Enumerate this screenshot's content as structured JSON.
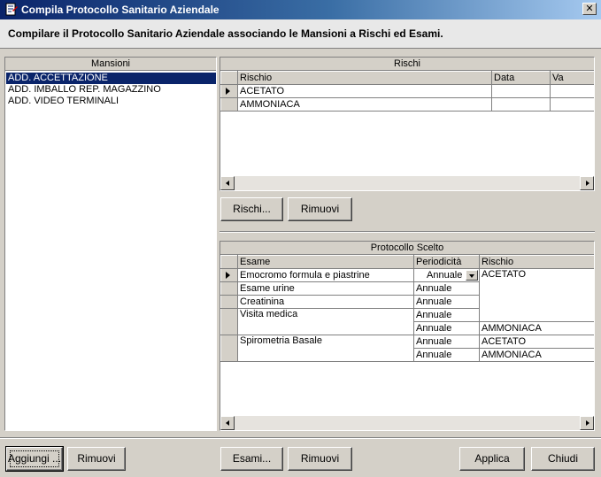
{
  "window": {
    "title": "Compila Protocollo Sanitario Aziendale",
    "close_glyph": "✕",
    "instruction": "Compilare il Protocollo Sanitario Aziendale associando le Mansioni a Rischi ed Esami."
  },
  "mansioni": {
    "caption": "Mansioni",
    "items": [
      "ADD. ACCETTAZIONE",
      "ADD. IMBALLO REP. MAGAZZINO",
      "ADD. VIDEO TERMINALI"
    ],
    "selected_index": 0
  },
  "rischi": {
    "caption": "Rischi",
    "columns": [
      "Rischio",
      "Data",
      "Va"
    ],
    "rows": [
      {
        "rischio": "ACETATO",
        "data": "",
        "va": ""
      },
      {
        "rischio": "AMMONIACA",
        "data": "",
        "va": ""
      }
    ],
    "buttons": {
      "add": "Rischi...",
      "remove": "Rimuovi"
    }
  },
  "protocollo": {
    "caption": "Protocollo Scelto",
    "columns": [
      "Esame",
      "Periodicità",
      "Rischio"
    ],
    "rows": [
      {
        "esame": "Emocromo formula e piastrine",
        "periodicita": "Annuale",
        "rischio": "ACETATO"
      },
      {
        "esame": "Esame urine",
        "periodicita": "Annuale",
        "rischio": ""
      },
      {
        "esame": "Creatinina",
        "periodicita": "Annuale",
        "rischio": ""
      },
      {
        "esame": "Visita medica",
        "periodicita": "Annuale",
        "rischio": ""
      },
      {
        "esame": "",
        "periodicita": "Annuale",
        "rischio": "AMMONIACA"
      },
      {
        "esame": "Spirometria Basale",
        "periodicita": "Annuale",
        "rischio": "ACETATO"
      },
      {
        "esame": "",
        "periodicita": "Annuale",
        "rischio": "AMMONIACA"
      }
    ]
  },
  "footer": {
    "aggiungi": "Aggiungi ...",
    "rimuovi_mansione": "Rimuovi",
    "esami": "Esami...",
    "rimuovi_esame": "Rimuovi",
    "applica": "Applica",
    "chiudi": "Chiudi"
  },
  "icons": {
    "window_icon": "form-icon",
    "row_indicator": "row-pointer-icon",
    "scroll_left": "arrow-left-icon",
    "scroll_right": "arrow-right-icon",
    "dropdown": "chevron-down-icon"
  }
}
